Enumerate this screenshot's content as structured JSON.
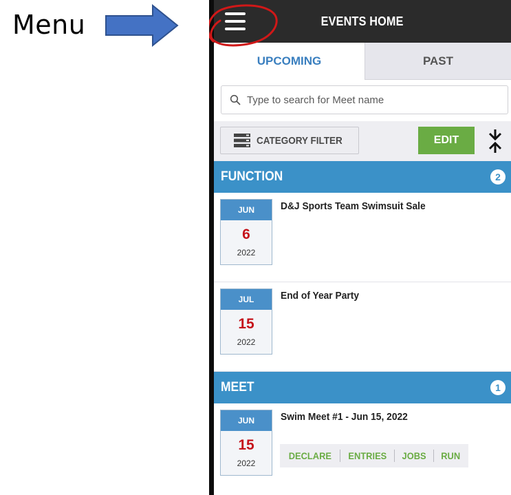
{
  "annotation": {
    "menu_label": "Menu",
    "arrow_color": "#4472c4",
    "circle_color": "#d01818"
  },
  "header": {
    "title": "EVENTS HOME",
    "menu_icon": "hamburger-menu-icon"
  },
  "tabs": [
    {
      "label": "UPCOMING",
      "active": true
    },
    {
      "label": "PAST",
      "active": false
    }
  ],
  "search": {
    "placeholder": "Type to search for Meet name",
    "value": ""
  },
  "toolbar": {
    "category_filter_label": "CATEGORY FILTER",
    "edit_label": "EDIT",
    "collapse_icon": "collapse-arrows-icon"
  },
  "sections": [
    {
      "title": "FUNCTION",
      "count": "2",
      "events": [
        {
          "month": "JUN",
          "day": "6",
          "year": "2022",
          "title": "D&J Sports Team Swimsuit Sale"
        },
        {
          "month": "JUL",
          "day": "15",
          "year": "2022",
          "title": "End of Year Party"
        }
      ]
    },
    {
      "title": "MEET",
      "count": "1",
      "events": [
        {
          "month": "JUN",
          "day": "15",
          "year": "2022",
          "title": "Swim Meet #1 - Jun 15, 2022",
          "actions": [
            "DECLARE",
            "ENTRIES",
            "JOBS",
            "RUN"
          ]
        }
      ]
    }
  ],
  "colors": {
    "header_bg": "#2b2b2b",
    "section_bg": "#3b91c8",
    "accent_green": "#6aac44",
    "date_red": "#c5141b",
    "tab_active_text": "#3a7fbf"
  }
}
